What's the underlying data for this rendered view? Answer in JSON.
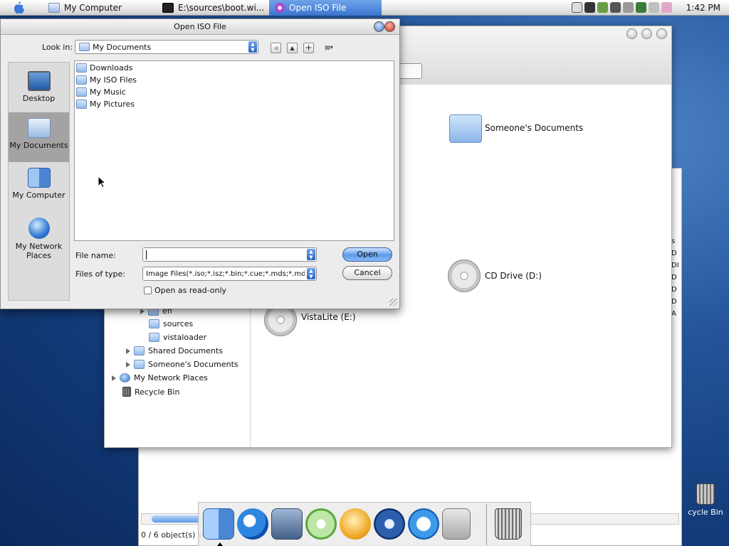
{
  "menubar": {
    "tasks": [
      {
        "label": "My Computer"
      },
      {
        "label": "E:\\sources\\boot.wi..."
      },
      {
        "label": "Open ISO File"
      }
    ],
    "clock": "1:42 PM"
  },
  "explorer": {
    "items": [
      {
        "label": "Someone's Documents",
        "icon": "folder-icon"
      },
      {
        "label": "CD Drive (D:)",
        "icon": "cd-drive-icon"
      },
      {
        "label": "VistaLite (E:)",
        "icon": "cd-drive-icon"
      }
    ],
    "tree": [
      {
        "label": "efi"
      },
      {
        "label": "sources"
      },
      {
        "label": "vistaloader"
      },
      {
        "label": "Shared Documents"
      },
      {
        "label": "Someone's Documents"
      },
      {
        "label": "My Network Places"
      },
      {
        "label": "Recycle Bin"
      }
    ],
    "right_column": [
      "s",
      "D",
      "DI",
      "D",
      "D",
      "D",
      "A"
    ],
    "status": "0 / 6 object(s) selected"
  },
  "dialog": {
    "title": "Open ISO File",
    "look_in_label": "Look in:",
    "look_in_value": "My Documents",
    "places": [
      {
        "label": "Desktop",
        "icon": "desktop-icon"
      },
      {
        "label": "My Documents",
        "icon": "my-documents-icon",
        "selected": true
      },
      {
        "label": "My Computer",
        "icon": "my-computer-icon"
      },
      {
        "label": "My Network Places",
        "icon": "network-places-icon"
      }
    ],
    "files": [
      {
        "label": "Downloads"
      },
      {
        "label": "My ISO Files"
      },
      {
        "label": "My Music"
      },
      {
        "label": "My Pictures"
      }
    ],
    "file_name_label": "File name:",
    "file_name_value": "",
    "file_type_label": "Files of type:",
    "file_type_value": "Image Files(*.iso;*.isz;*.bin;*.cue;*.mds;*.mdf;*.nrg",
    "readonly_label": "Open as read-only",
    "readonly_checked": false,
    "open_label": "Open",
    "cancel_label": "Cancel"
  },
  "desktop": {
    "recycle_label": "cycle Bin"
  },
  "dock": {
    "icons": [
      "finder-icon",
      "internet-explorer-icon",
      "preview-icon",
      "itunes-icon",
      "media-player-icon",
      "imovie-icon",
      "quicktime-icon",
      "system-prefs-icon",
      "trash-icon"
    ]
  }
}
